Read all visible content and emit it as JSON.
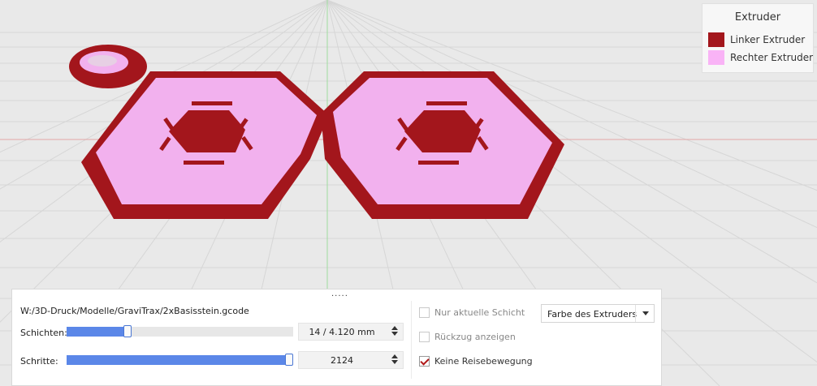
{
  "legend": {
    "title": "Extruder",
    "items": [
      {
        "label": "Linker Extruder",
        "color": "#a3161c"
      },
      {
        "label": "Rechter Extruder",
        "color": "#f9b3f6"
      }
    ]
  },
  "panel": {
    "file_path": "W:/3D-Druck/Modelle/GraviTrax/2xBasisstein.gcode",
    "layers": {
      "label": "Schichten:",
      "value": "14 / 4.120 mm",
      "fraction": 0.26
    },
    "steps": {
      "label": "Schritte:",
      "value": "2124",
      "fraction": 1.0
    },
    "checkboxes": [
      {
        "label": "Nur aktuelle Schicht",
        "checked": false
      },
      {
        "label": "Rückzug anzeigen",
        "checked": false
      },
      {
        "label": "Keine Reisebewegung",
        "checked": true
      }
    ],
    "color_mode": {
      "selected": "Farbe des Extruders"
    }
  },
  "colors": {
    "extruder_left": "#a3161c",
    "extruder_right": "#f2b1ee",
    "background": "#e9e9e9",
    "grid": "#d6d6d6",
    "axis_x": "#e3a7a7",
    "axis_y": "#9fdc9f",
    "slider_fill": "#5b87e8"
  }
}
